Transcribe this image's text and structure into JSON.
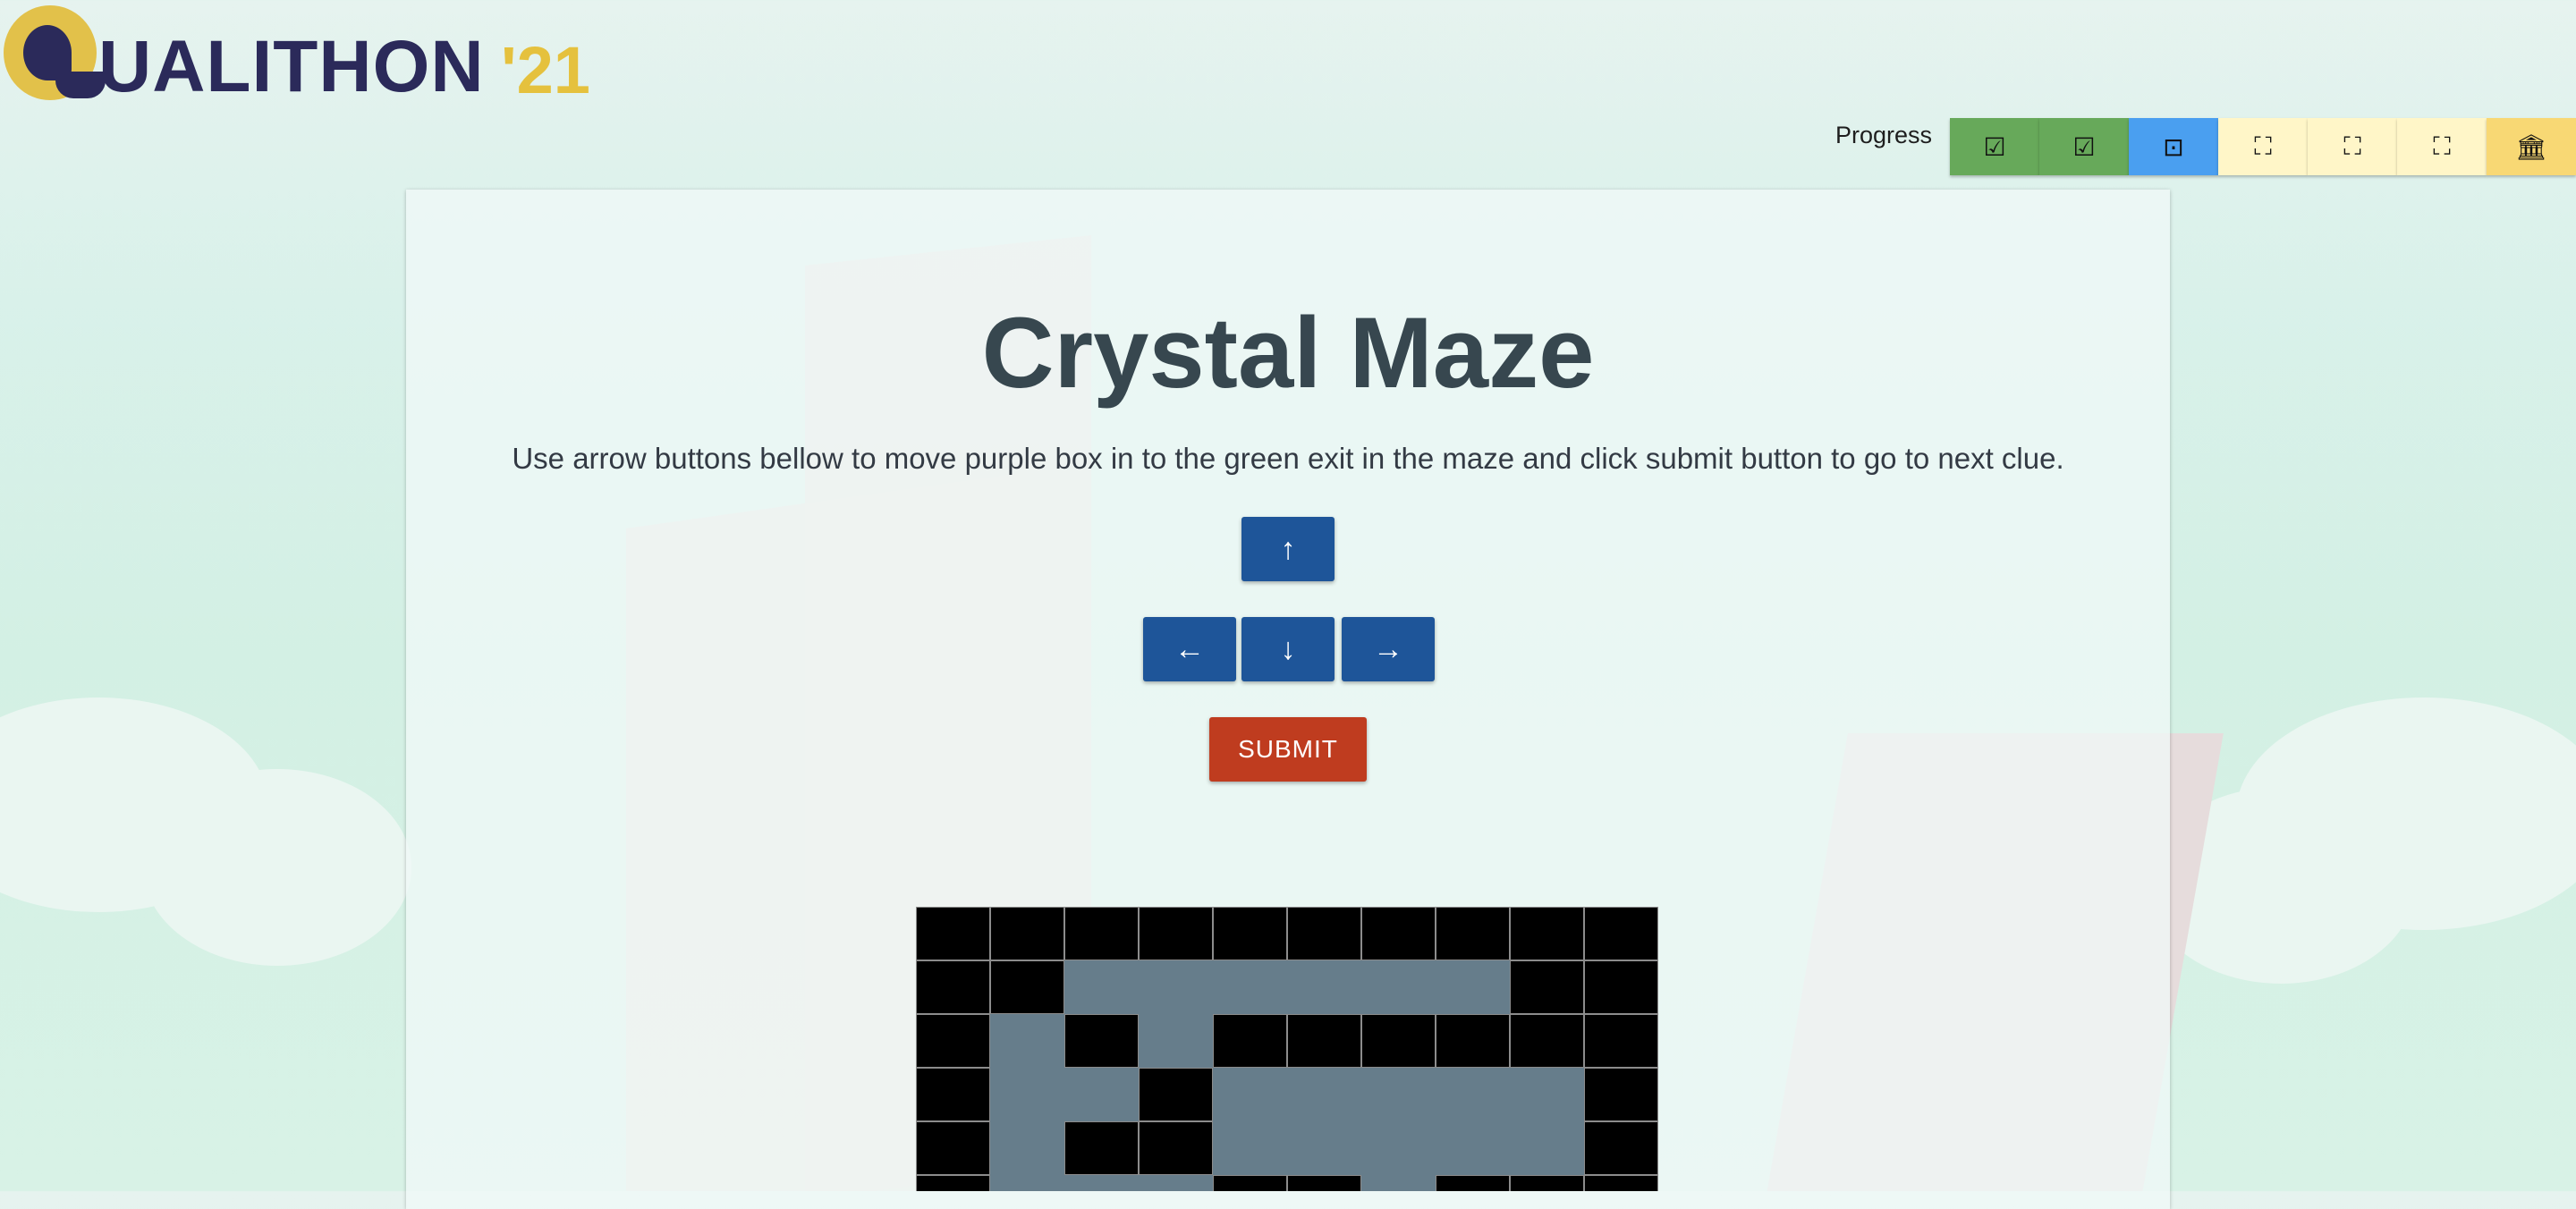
{
  "header": {
    "logo_initial": "Q",
    "logo_text": "UALITHON",
    "logo_year": "'21"
  },
  "progress": {
    "label": "Progress",
    "steps": [
      {
        "status": "done",
        "icon": "check-box-icon",
        "glyph": "☑"
      },
      {
        "status": "done",
        "icon": "check-box-icon",
        "glyph": "☑"
      },
      {
        "status": "current",
        "icon": "center-focus-icon",
        "glyph": "⊡"
      },
      {
        "status": "todo",
        "icon": "fullscreen-frame-icon",
        "glyph": "⛶"
      },
      {
        "status": "todo",
        "icon": "fullscreen-frame-icon",
        "glyph": "⛶"
      },
      {
        "status": "todo",
        "icon": "fullscreen-frame-icon",
        "glyph": "⛶"
      },
      {
        "status": "final",
        "icon": "bank-icon",
        "glyph": "🏛"
      }
    ]
  },
  "puzzle": {
    "title": "Crystal Maze",
    "instructions": "Use arrow buttons bellow to move purple box in to the green exit in the maze and click submit button to go to next clue.",
    "controls": {
      "up": "↑",
      "left": "←",
      "down": "↓",
      "right": "→"
    },
    "submit_label": "SUBMIT"
  },
  "maze": {
    "cols": 10,
    "visible_rows": 6,
    "colors": {
      "wall": "#000000",
      "path": "#667d8b"
    },
    "grid": [
      "##########",
      "##......##",
      "#.#.######",
      "#..#.....#",
      "#.##.....#",
      "#...##.###"
    ]
  },
  "colors": {
    "brand_navy": "#2b2a5a",
    "brand_gold": "#e5c13d",
    "button_blue": "#1e5599",
    "submit_red": "#bf3c1f",
    "title_gray": "#37474f"
  }
}
